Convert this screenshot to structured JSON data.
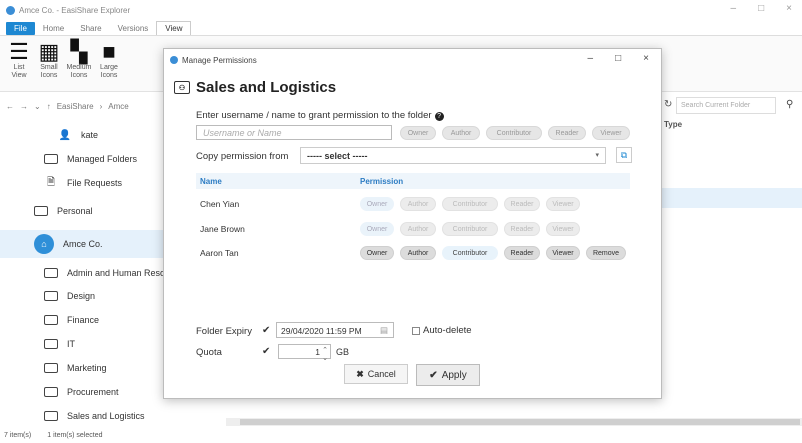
{
  "window": {
    "title": "Amce Co. - EasiShare Explorer",
    "controls": {
      "minimize": "–",
      "maximize": "□",
      "close": "×"
    }
  },
  "ribbon": {
    "tabs": [
      "File",
      "Home",
      "Share",
      "Versions",
      "View"
    ],
    "view_buttons": [
      {
        "line1": "List",
        "line2": "View",
        "icon": "list-view-icon"
      },
      {
        "line1": "Small",
        "line2": "Icons",
        "icon": "small-icons-icon"
      },
      {
        "line1": "Medium",
        "line2": "Icons",
        "icon": "medium-icons-icon"
      },
      {
        "line1": "Large",
        "line2": "Icons",
        "icon": "large-icons-icon"
      }
    ]
  },
  "address": {
    "breadcrumb": [
      "EasiShare",
      "Amce"
    ],
    "search_placeholder": "Search Current Folder"
  },
  "tree": {
    "items": [
      {
        "label": "kate",
        "icon": "user-icon"
      },
      {
        "label": "Managed Folders",
        "icon": "managed-folder-icon"
      },
      {
        "label": "File Requests",
        "icon": "file-request-icon"
      },
      {
        "label": "Personal",
        "icon": "drive-icon"
      },
      {
        "label": "Amce Co.",
        "icon": "team-drive-icon"
      },
      {
        "label": "Admin and Human Resou",
        "icon": "shared-folder-icon"
      },
      {
        "label": "Design",
        "icon": "shared-folder-icon"
      },
      {
        "label": "Finance",
        "icon": "shared-folder-icon"
      },
      {
        "label": "IT",
        "icon": "shared-folder-icon"
      },
      {
        "label": "Marketing",
        "icon": "shared-folder-icon"
      },
      {
        "label": "Procurement",
        "icon": "shared-folder-icon"
      },
      {
        "label": "Sales and Logistics",
        "icon": "shared-folder-icon"
      }
    ]
  },
  "list": {
    "column_type": "Type"
  },
  "status": {
    "items": "7 item(s)",
    "selected": "1 item(s) selected"
  },
  "dialog": {
    "title": "Manage Permissions",
    "heading": "Sales and Logistics",
    "prompt": "Enter username / name to grant permission to the folder",
    "user_placeholder": "Username or Name",
    "permission_buttons": [
      "Owner",
      "Author",
      "Contributor",
      "Reader",
      "Viewer"
    ],
    "copy_label": "Copy permission from",
    "copy_select": "----- select -----",
    "table_headers": {
      "name": "Name",
      "permission": "Permission"
    },
    "rows": [
      {
        "name": "Chen Yian",
        "buttons": [
          "Owner",
          "Author",
          "Contributor",
          "Reader",
          "Viewer"
        ]
      },
      {
        "name": "Jane Brown",
        "buttons": [
          "Owner",
          "Author",
          "Contributor",
          "Reader",
          "Viewer"
        ]
      },
      {
        "name": "Aaron Tan",
        "buttons": [
          "Owner",
          "Author",
          "Contributor",
          "Reader",
          "Viewer",
          "Remove"
        ]
      }
    ],
    "expiry_label": "Folder Expiry",
    "expiry_value": "29/04/2020 11:59 PM",
    "autodelete_label": "Auto-delete",
    "quota_label": "Quota",
    "quota_value": "1",
    "quota_unit": "GB",
    "cancel_label": "Cancel",
    "apply_label": "Apply"
  }
}
